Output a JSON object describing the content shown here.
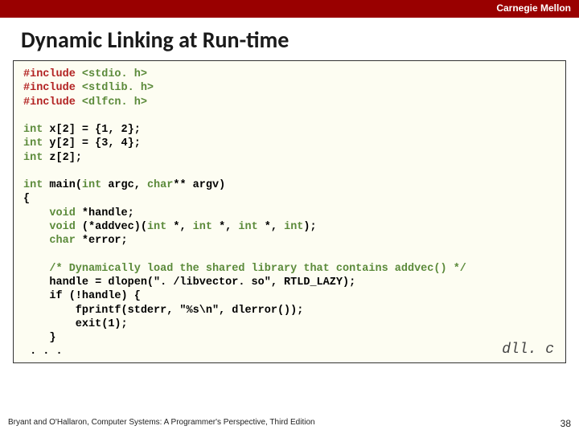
{
  "university": "Carnegie Mellon",
  "title": "Dynamic Linking at Run-time",
  "code": {
    "l1a": "#include",
    "l1b": "<stdio. h>",
    "l2a": "#include",
    "l2b": "<stdlib. h>",
    "l3a": "#include",
    "l3b": "<dlfcn. h>",
    "l5a": "int",
    "l5b": " x[2] = {1, 2};",
    "l6a": "int",
    "l6b": " y[2] = {3, 4};",
    "l7a": "int",
    "l7b": " z[2];",
    "l9a": "int",
    "l9b": " main(",
    "l9c": "int",
    "l9d": " argc, ",
    "l9e": "char",
    "l9f": "** argv)",
    "l10": "{",
    "l11a": "    ",
    "l11b": "void",
    "l11c": " *handle;",
    "l12a": "    ",
    "l12b": "void",
    "l12c": " (*addvec)(",
    "l12d": "int",
    "l12e": " *, ",
    "l12f": "int",
    "l12g": " *, ",
    "l12h": "int",
    "l12i": " *, ",
    "l12j": "int",
    "l12k": ");",
    "l13a": "    ",
    "l13b": "char",
    "l13c": " *error;",
    "l15a": "    ",
    "l15b": "/* Dynamically load the shared library that contains addvec() */",
    "l16": "    handle = dlopen(\". /libvector. so\", RTLD_LAZY);",
    "l17": "    if (!handle) {",
    "l18": "        fprintf(stderr, \"%s\\n\", dlerror());",
    "l19": "        exit(1);",
    "l20": "    }",
    "l21": " . . ."
  },
  "filename": "dll. c",
  "footer_left": "Bryant and O'Hallaron, Computer Systems: A Programmer's Perspective, Third Edition",
  "footer_right": "38"
}
